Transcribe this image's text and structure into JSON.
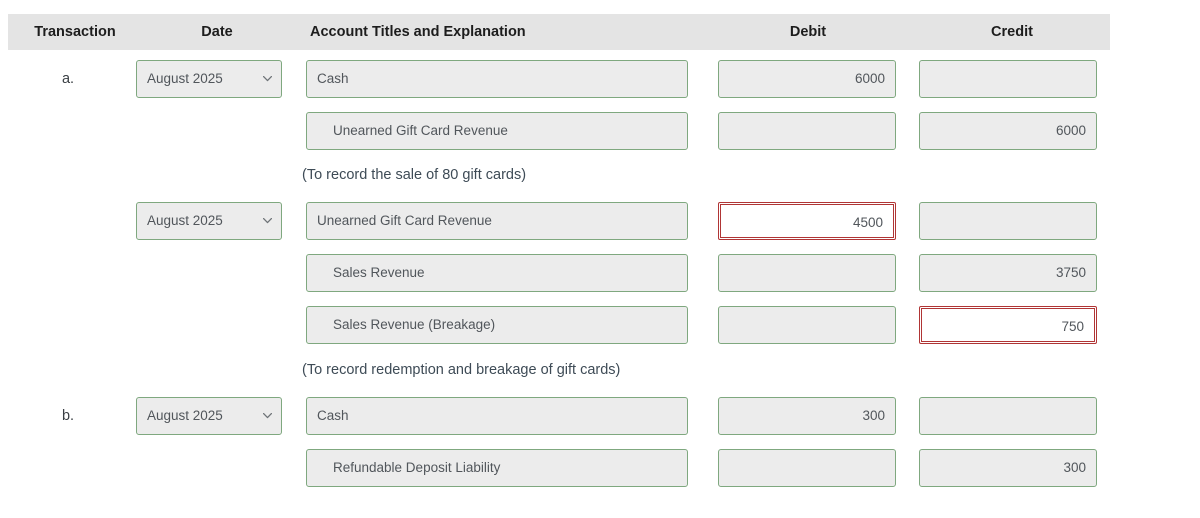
{
  "table": {
    "columns": [
      {
        "key": "transaction",
        "label": "Transaction"
      },
      {
        "key": "date",
        "label": "Date"
      },
      {
        "key": "account",
        "label": "Account Titles and Explanation"
      },
      {
        "key": "debit",
        "label": "Debit"
      },
      {
        "key": "credit",
        "label": "Credit"
      }
    ],
    "header_background": "#e4e4e4",
    "field_border_color": "#7fa87f",
    "field_background": "#ececec",
    "error_border_color": "#b03535"
  },
  "rows": [
    {
      "transaction": "a.",
      "date_value": "August 2025",
      "account_value": "Cash",
      "account_indent": false,
      "debit_value": "6000",
      "credit_value": "",
      "debit_error": false,
      "credit_error": false
    },
    {
      "transaction": "",
      "date_value": "",
      "account_value": "Unearned Gift Card Revenue",
      "account_indent": true,
      "debit_value": "",
      "credit_value": "6000",
      "debit_error": false,
      "credit_error": false
    },
    {
      "explanation": "(To record the sale of 80 gift cards)"
    },
    {
      "transaction": "",
      "date_value": "August 2025",
      "account_value": "Unearned Gift Card Revenue",
      "account_indent": false,
      "debit_value": "4500",
      "credit_value": "",
      "debit_error": true,
      "credit_error": false
    },
    {
      "transaction": "",
      "date_value": "",
      "account_value": "Sales Revenue",
      "account_indent": true,
      "debit_value": "",
      "credit_value": "3750",
      "debit_error": false,
      "credit_error": false
    },
    {
      "transaction": "",
      "date_value": "",
      "account_value": "Sales Revenue (Breakage)",
      "account_indent": true,
      "debit_value": "",
      "credit_value": "750",
      "debit_error": false,
      "credit_error": true
    },
    {
      "explanation": "(To record redemption and breakage of gift cards)"
    },
    {
      "transaction": "b.",
      "date_value": "August 2025",
      "account_value": "Cash",
      "account_indent": false,
      "debit_value": "300",
      "credit_value": "",
      "debit_error": false,
      "credit_error": false
    },
    {
      "transaction": "",
      "date_value": "",
      "account_value": "Refundable Deposit Liability",
      "account_indent": true,
      "debit_value": "",
      "credit_value": "300",
      "debit_error": false,
      "credit_error": false
    }
  ],
  "icons": {
    "chevron_down": "chevron-down-icon"
  },
  "layout": {
    "row_top_positions": [
      56,
      108,
      160,
      198,
      250,
      302,
      355,
      393,
      445
    ]
  }
}
